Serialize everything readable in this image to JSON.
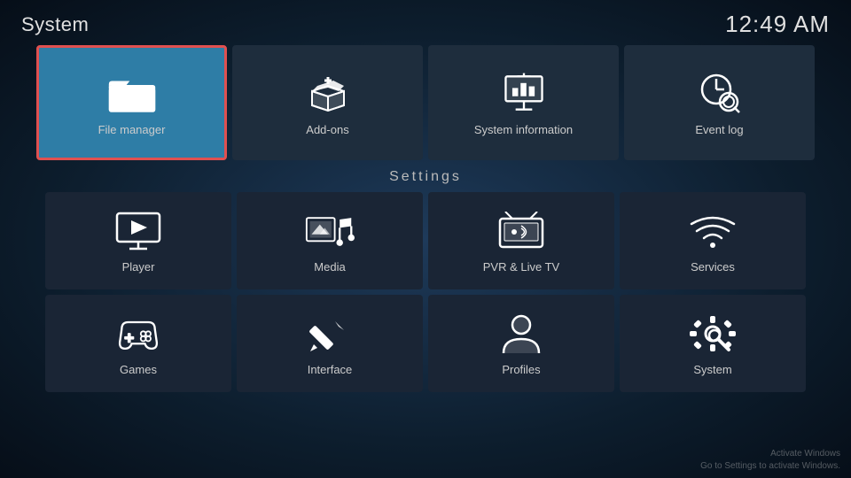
{
  "header": {
    "title": "System",
    "time": "12:49 AM"
  },
  "top_tiles": [
    {
      "id": "file-manager",
      "label": "File manager",
      "selected": true
    },
    {
      "id": "add-ons",
      "label": "Add-ons",
      "selected": false
    },
    {
      "id": "system-information",
      "label": "System information",
      "selected": false
    },
    {
      "id": "event-log",
      "label": "Event log",
      "selected": false
    }
  ],
  "settings_header": "Settings",
  "settings_row1": [
    {
      "id": "player",
      "label": "Player"
    },
    {
      "id": "media",
      "label": "Media"
    },
    {
      "id": "pvr-live-tv",
      "label": "PVR & Live TV"
    },
    {
      "id": "services",
      "label": "Services"
    }
  ],
  "settings_row2": [
    {
      "id": "games",
      "label": "Games"
    },
    {
      "id": "interface",
      "label": "Interface"
    },
    {
      "id": "profiles",
      "label": "Profiles"
    },
    {
      "id": "system",
      "label": "System"
    }
  ],
  "windows_watermark": {
    "line1": "Activate Windows",
    "line2": "Go to Settings to activate Windows."
  }
}
